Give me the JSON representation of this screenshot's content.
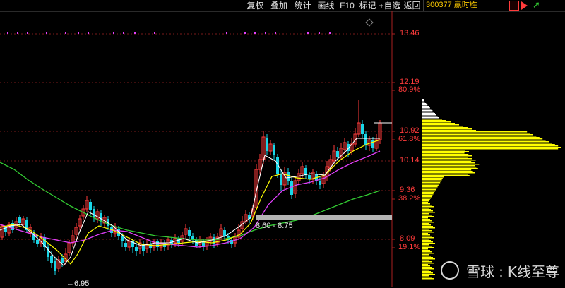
{
  "toolbar": {
    "buttons": [
      "复权",
      "叠加",
      "统计",
      "画线",
      "F10",
      "标记",
      "+自选",
      "返回"
    ]
  },
  "header": {
    "stock_code": "300377",
    "stock_name": "赢时胜"
  },
  "axis": {
    "price_ticks": [
      "13.46",
      "12.19",
      "10.92",
      "10.14",
      "9.36",
      "8.09"
    ],
    "pct_ticks": [
      "80.9%",
      "61.8%",
      "38.2%",
      "19.1%"
    ]
  },
  "annotations": {
    "range_label": "8.60 - 8.75",
    "low_label": "←6.95"
  },
  "colors": {
    "up": "#ff3b3b",
    "down": "#19d6e8",
    "ma5": "#ffffff",
    "ma10": "#ffff00",
    "ma20": "#e040fb",
    "ma60": "#33cc33",
    "volume_profile": "#ffff00",
    "band": "#b4b4b4"
  },
  "watermark": {
    "brand": "雪球",
    "title": "K线至尊"
  },
  "icons": [
    "pin-icon",
    "next-icon",
    "expand-icon",
    "diamond-icon"
  ]
}
